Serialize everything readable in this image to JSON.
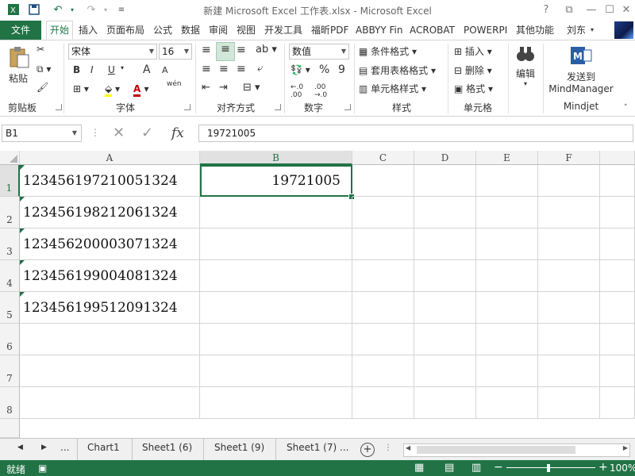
{
  "window": {
    "title": "新建 Microsoft Excel 工作表.xlsx - Microsoft Excel",
    "help": "?",
    "restore": "⧉",
    "minimize": "—",
    "maximize": "☐",
    "close": "✕"
  },
  "tabs": {
    "file": "文件",
    "items": [
      "开始",
      "插入",
      "页面布局",
      "公式",
      "数据",
      "审阅",
      "视图",
      "开发工具",
      "福昕PDF",
      "ABBYY Fin",
      "ACROBAT",
      "POWERPI",
      "其他功能"
    ],
    "user": "刘东"
  },
  "ribbon": {
    "clipboard": {
      "paste": "粘贴",
      "label": "剪贴板"
    },
    "font": {
      "name": "宋体",
      "size": "16",
      "bold": "B",
      "italic": "I",
      "underline": "U",
      "grow": "A",
      "shrink": "A",
      "wen": "wén",
      "label": "字体"
    },
    "alignment": {
      "label": "对齐方式"
    },
    "number": {
      "format": "数值",
      "percent": "%",
      "comma": "9",
      "label": "数字"
    },
    "styles": {
      "conditional": "条件格式",
      "table": "套用表格格式",
      "cell": "单元格样式",
      "label": "样式"
    },
    "cells": {
      "insert": "插入",
      "delete": "删除",
      "format": "格式",
      "label": "单元格"
    },
    "editing": {
      "label": "编辑"
    },
    "mindjet": {
      "send_line1": "发送到",
      "send_line2": "MindManager",
      "label": "Mindjet"
    }
  },
  "formula_bar": {
    "name_box": "B1",
    "cancel": "✕",
    "enter": "✓",
    "fx": "fx",
    "value": "19721005"
  },
  "columns": [
    "A",
    "B",
    "C",
    "D",
    "E",
    "F"
  ],
  "rows": [
    {
      "num": "1",
      "a": "123456197210051324",
      "b": "19721005"
    },
    {
      "num": "2",
      "a": "123456198212061324",
      "b": ""
    },
    {
      "num": "3",
      "a": "123456200003071324",
      "b": ""
    },
    {
      "num": "4",
      "a": "123456199004081324",
      "b": ""
    },
    {
      "num": "5",
      "a": "123456199512091324",
      "b": ""
    },
    {
      "num": "6",
      "a": "",
      "b": ""
    },
    {
      "num": "7",
      "a": "",
      "b": ""
    },
    {
      "num": "8",
      "a": "",
      "b": ""
    }
  ],
  "sheets": {
    "prev": "◀",
    "next": "▶",
    "more": "...",
    "names": [
      "Chart1",
      "Sheet1 (6)",
      "Sheet1 (9)",
      "Sheet1 (7)"
    ],
    "add": "+"
  },
  "status": {
    "ready": "就绪",
    "zoom": "100%"
  }
}
